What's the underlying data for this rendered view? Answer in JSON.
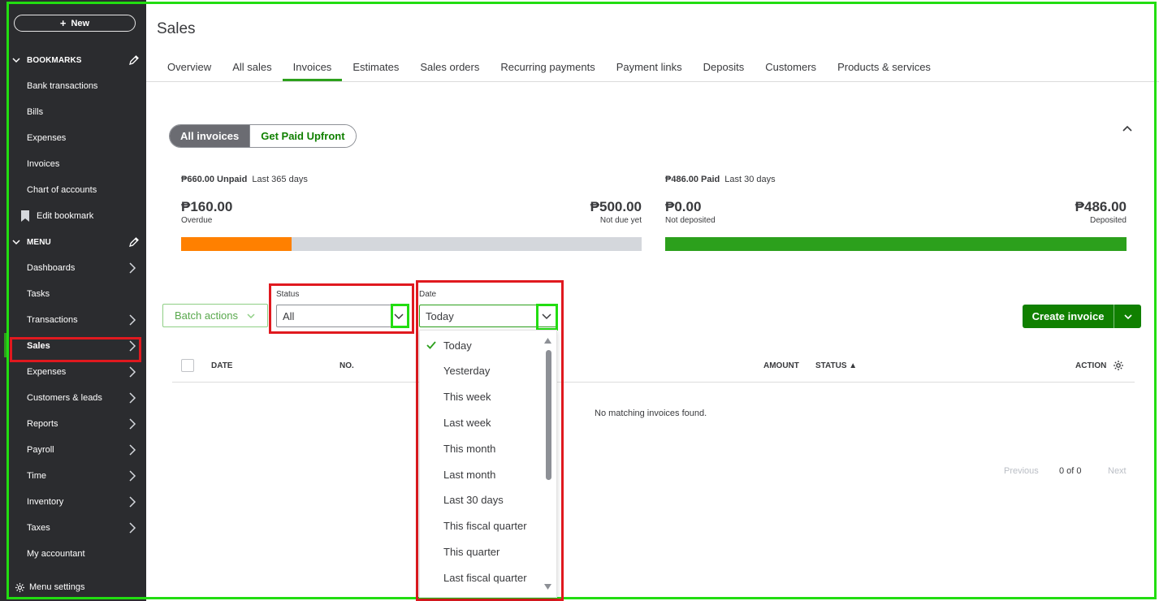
{
  "sidebar": {
    "new_label": "New",
    "bookmarks_header": "BOOKMARKS",
    "bookmarks": [
      "Bank transactions",
      "Bills",
      "Expenses",
      "Invoices",
      "Chart of accounts"
    ],
    "edit_bookmark": "Edit bookmark",
    "menu_header": "MENU",
    "menu_items": [
      {
        "label": "Dashboards",
        "has_arrow": true
      },
      {
        "label": "Tasks",
        "has_arrow": false
      },
      {
        "label": "Transactions",
        "has_arrow": true
      },
      {
        "label": "Sales",
        "has_arrow": true
      },
      {
        "label": "Expenses",
        "has_arrow": true
      },
      {
        "label": "Customers & leads",
        "has_arrow": true
      },
      {
        "label": "Reports",
        "has_arrow": true
      },
      {
        "label": "Payroll",
        "has_arrow": true
      },
      {
        "label": "Time",
        "has_arrow": true
      },
      {
        "label": "Inventory",
        "has_arrow": true
      },
      {
        "label": "Taxes",
        "has_arrow": true
      },
      {
        "label": "My accountant",
        "has_arrow": false
      }
    ],
    "menu_settings": "Menu settings"
  },
  "page": {
    "title": "Sales",
    "tabs": [
      "Overview",
      "All sales",
      "Invoices",
      "Estimates",
      "Sales orders",
      "Recurring payments",
      "Payment links",
      "Deposits",
      "Customers",
      "Products & services"
    ],
    "active_tab": "Invoices"
  },
  "toggle": {
    "all": "All invoices",
    "upfront": "Get Paid Upfront"
  },
  "summary": {
    "unpaid": {
      "amount": "₱660.00 Unpaid",
      "period": "Last 365 days",
      "left_value": "₱160.00",
      "left_label": "Overdue",
      "right_value": "₱500.00",
      "right_label": "Not due yet",
      "fill_fraction": 0.24,
      "fill_color": "#ff8000"
    },
    "paid": {
      "amount": "₱486.00 Paid",
      "period": "Last 30 days",
      "left_value": "₱0.00",
      "left_label": "Not deposited",
      "right_value": "₱486.00",
      "right_label": "Deposited",
      "fill_fraction": 1.0,
      "fill_color": "#2ca01c"
    }
  },
  "filters": {
    "batch_actions": "Batch actions",
    "status_label": "Status",
    "status_value": "All",
    "date_label": "Date",
    "date_value": "Today"
  },
  "create_invoice": "Create invoice",
  "table": {
    "columns": [
      "DATE",
      "NO.",
      "AMOUNT",
      "STATUS ▲",
      "ACTION"
    ],
    "empty_message": "No matching invoices found."
  },
  "pagination": {
    "previous": "Previous",
    "range": "0 of 0",
    "next": "Next"
  },
  "date_options": [
    "Today",
    "Yesterday",
    "This week",
    "Last week",
    "This month",
    "Last month",
    "Last 30 days",
    "This fiscal quarter",
    "This quarter",
    "Last fiscal quarter"
  ],
  "date_selected": "Today",
  "colors": {
    "brand_green": "#108000",
    "accent_green": "#2ca01c",
    "overdue_orange": "#ff8000",
    "sidebar": "#2b2c2f",
    "annotation_red": "#e0191f",
    "annotation_green": "#22dd11"
  }
}
